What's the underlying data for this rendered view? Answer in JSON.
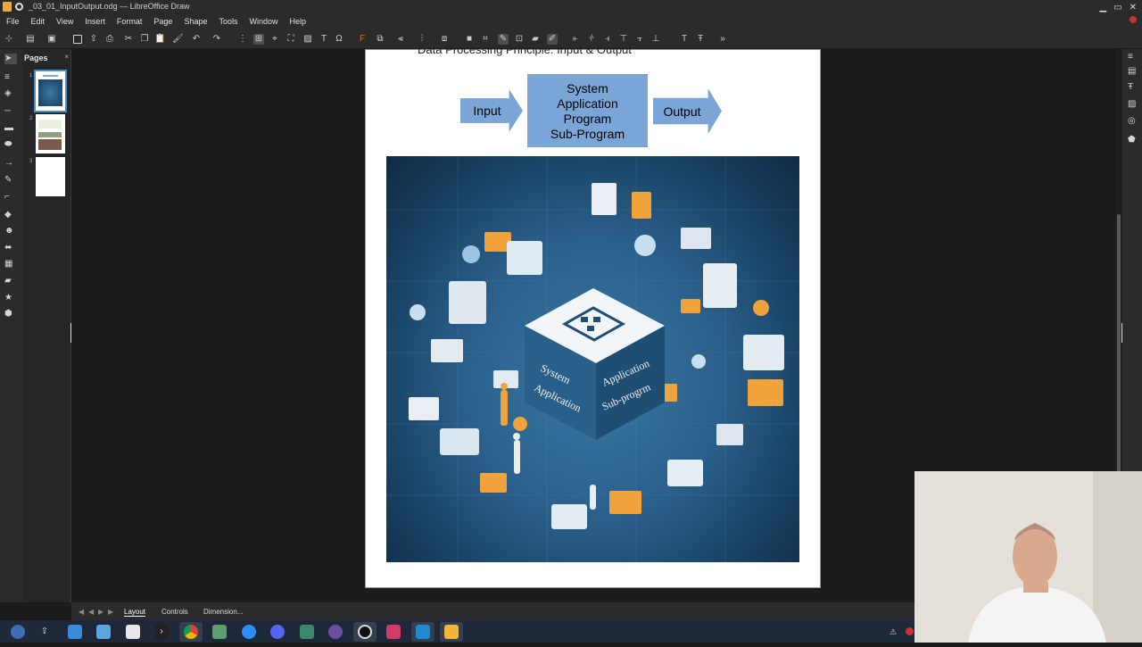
{
  "window": {
    "title": "_03_01_InputOutput.odg — LibreOffice Draw"
  },
  "menu": [
    "File",
    "Edit",
    "View",
    "Insert",
    "Format",
    "Page",
    "Shape",
    "Tools",
    "Window",
    "Help"
  ],
  "pages_panel": {
    "title": "Pages",
    "close": "×",
    "pages": [
      {
        "number": "1",
        "selected": true
      },
      {
        "number": "2",
        "selected": false
      },
      {
        "number": "3",
        "selected": false
      }
    ]
  },
  "slide": {
    "heading": "Data Processing Principle: Input & Output",
    "input_label": "Input",
    "output_label": "Output",
    "center_lines": [
      "System",
      "Application",
      "Program",
      "Sub-Program"
    ],
    "cube_left_text": [
      "System",
      "Application"
    ],
    "cube_right_text": [
      "Application",
      "Sub-progrm"
    ],
    "box_color": "#7aa5d6"
  },
  "tabs": {
    "items": [
      "Layout",
      "Controls",
      "Dimension..."
    ],
    "active": "Layout"
  },
  "colors": {
    "chrome": "#2b2b2b",
    "canvas": "#1c1c1c",
    "accent": "#4a90c8"
  }
}
